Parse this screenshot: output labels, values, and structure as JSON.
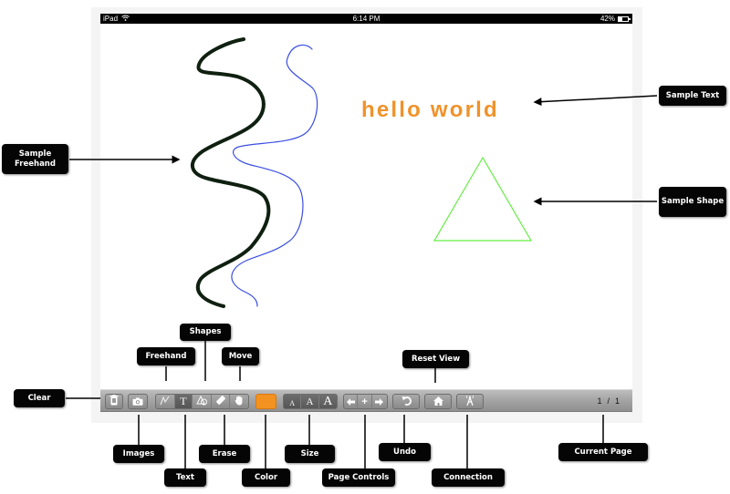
{
  "status_bar": {
    "device": "iPad",
    "wifi_icon": "wifi-icon",
    "time": "6:14 PM",
    "battery_percent": "42%",
    "battery_level": 0.42
  },
  "canvas": {
    "sample_text": "hello world",
    "colors": {
      "text": "#f0922a",
      "thick_stroke": "#0f2010",
      "thin_stroke": "#3a4ee0",
      "shape": "#66ee44"
    }
  },
  "toolbar": {
    "buttons": {
      "clear": {
        "icon": "trash-icon"
      },
      "images": {
        "icon": "camera-icon"
      },
      "freehand": {
        "icon": "freehand-squiggle-icon"
      },
      "text": {
        "icon": "text-t-icon",
        "glyph": "T"
      },
      "shapes": {
        "icon": "shapes-icon"
      },
      "erase": {
        "icon": "eraser-icon"
      },
      "move": {
        "icon": "hand-icon"
      },
      "color": {
        "value": "#f39220"
      },
      "size_small": {
        "glyph": "A"
      },
      "size_medium": {
        "glyph": "A"
      },
      "size_large": {
        "glyph": "A"
      },
      "page_prev": {
        "icon": "arrow-left-icon"
      },
      "page_add": {
        "icon": "plus-icon",
        "glyph": "+"
      },
      "page_next": {
        "icon": "arrow-right-icon"
      },
      "undo": {
        "icon": "undo-icon"
      },
      "reset_view": {
        "icon": "home-icon"
      },
      "connection": {
        "icon": "antenna-icon"
      }
    },
    "current_page": "1",
    "page_separator": "/",
    "total_pages": "1"
  },
  "callouts": {
    "sample_freehand": "Sample Freehand",
    "sample_text": "Sample Text",
    "sample_shape": "Sample Shape",
    "clear": "Clear",
    "freehand": "Freehand",
    "shapes": "Shapes",
    "move": "Move",
    "reset_view": "Reset View",
    "images": "Images",
    "text": "Text",
    "erase": "Erase",
    "color": "Color",
    "size": "Size",
    "page_controls": "Page Controls",
    "undo": "Undo",
    "connection": "Connection",
    "current_page": "Current Page"
  }
}
